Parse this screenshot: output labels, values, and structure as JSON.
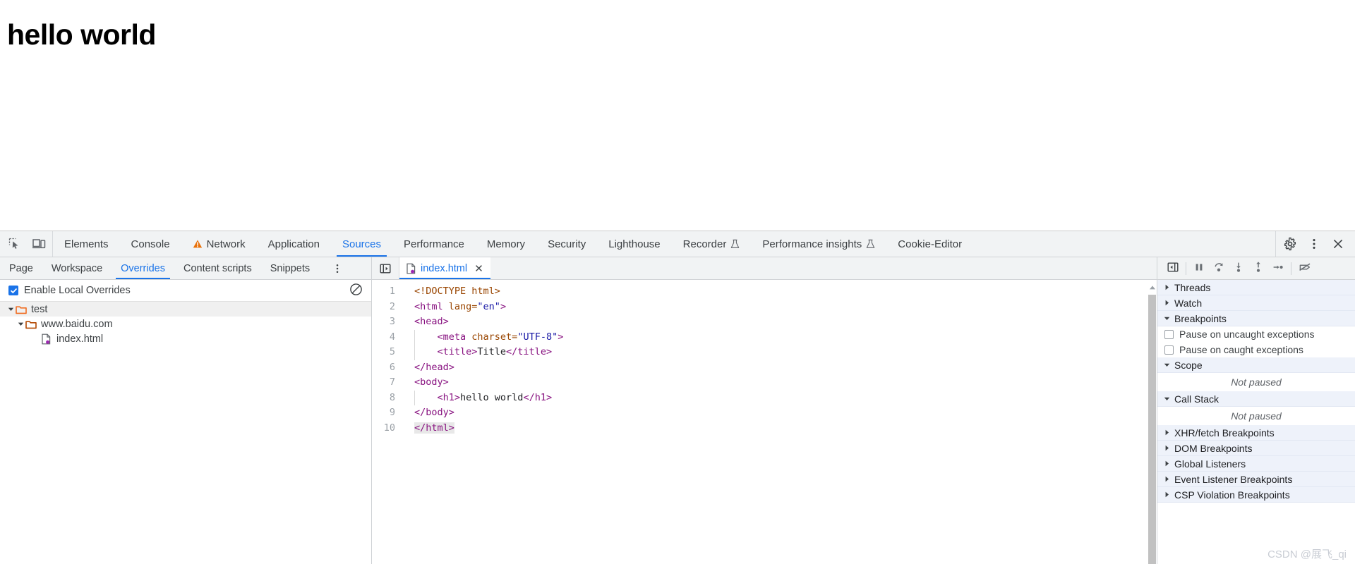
{
  "page": {
    "heading": "hello world"
  },
  "devtools": {
    "left_icons": [
      {
        "name": "inspect-element-icon"
      },
      {
        "name": "device-toolbar-icon"
      }
    ],
    "tabs": [
      {
        "label": "Elements",
        "active": false,
        "icon": null
      },
      {
        "label": "Console",
        "active": false,
        "icon": null
      },
      {
        "label": "Network",
        "active": false,
        "icon": "warning-icon"
      },
      {
        "label": "Application",
        "active": false,
        "icon": null
      },
      {
        "label": "Sources",
        "active": true,
        "icon": null
      },
      {
        "label": "Performance",
        "active": false,
        "icon": null
      },
      {
        "label": "Memory",
        "active": false,
        "icon": null
      },
      {
        "label": "Security",
        "active": false,
        "icon": null
      },
      {
        "label": "Lighthouse",
        "active": false,
        "icon": null
      },
      {
        "label": "Recorder",
        "active": false,
        "icon": "flask-icon"
      },
      {
        "label": "Performance insights",
        "active": false,
        "icon": "flask-icon"
      },
      {
        "label": "Cookie-Editor",
        "active": false,
        "icon": null
      }
    ],
    "right_icons": [
      {
        "name": "settings-gear-icon"
      },
      {
        "name": "more-options-icon"
      },
      {
        "name": "close-icon"
      }
    ],
    "accent_color": "#1a73e8",
    "warning_color": "#e8710a"
  },
  "navigator": {
    "tabs": [
      {
        "label": "Page",
        "active": false
      },
      {
        "label": "Workspace",
        "active": false
      },
      {
        "label": "Overrides",
        "active": true
      },
      {
        "label": "Content scripts",
        "active": false
      },
      {
        "label": "Snippets",
        "active": false
      }
    ],
    "more_label": "More tabs",
    "overrides": {
      "checkbox_label": "Enable Local Overrides",
      "checked": true,
      "clear_button_label": "Clear all overrides"
    },
    "tree": [
      {
        "label": "test",
        "type": "folder",
        "depth": 0,
        "expanded": true,
        "selected": true,
        "folder_color": "#f06c21"
      },
      {
        "label": "www.baidu.com",
        "type": "folder",
        "depth": 1,
        "expanded": true,
        "selected": false,
        "folder_color": "#b34700"
      },
      {
        "label": "index.html",
        "type": "file",
        "depth": 2,
        "expanded": false,
        "selected": false,
        "badge_color": "#9c27b0"
      }
    ]
  },
  "editor": {
    "panel_toggle_label": "Hide navigator",
    "open_file": {
      "name": "index.html",
      "close_label": "Close",
      "has_override_badge": true
    },
    "line_numbers": [
      "1",
      "2",
      "3",
      "4",
      "5",
      "6",
      "7",
      "8",
      "9",
      "10"
    ],
    "code_lines": [
      {
        "n": 1,
        "segments": [
          {
            "t": "<!DOCTYPE html>",
            "c": "tk-doc"
          }
        ]
      },
      {
        "n": 2,
        "segments": [
          {
            "t": "<html ",
            "c": "tk-tag"
          },
          {
            "t": "lang=",
            "c": "tk-attr"
          },
          {
            "t": "\"en\"",
            "c": "tk-val"
          },
          {
            "t": ">",
            "c": "tk-tag"
          }
        ]
      },
      {
        "n": 3,
        "segments": [
          {
            "t": "<head>",
            "c": "tk-tag"
          }
        ]
      },
      {
        "n": 4,
        "segments": [
          {
            "t": "    <meta ",
            "c": "tk-tag"
          },
          {
            "t": "charset=",
            "c": "tk-attr"
          },
          {
            "t": "\"UTF-8\"",
            "c": "tk-val"
          },
          {
            "t": ">",
            "c": "tk-tag"
          }
        ]
      },
      {
        "n": 5,
        "segments": [
          {
            "t": "    <title>",
            "c": "tk-tag"
          },
          {
            "t": "Title",
            "c": "tk-text"
          },
          {
            "t": "</title>",
            "c": "tk-tag"
          }
        ]
      },
      {
        "n": 6,
        "segments": [
          {
            "t": "</head>",
            "c": "tk-tag"
          }
        ]
      },
      {
        "n": 7,
        "segments": [
          {
            "t": "<body>",
            "c": "tk-tag"
          }
        ]
      },
      {
        "n": 8,
        "segments": [
          {
            "t": "    <h1>",
            "c": "tk-tag"
          },
          {
            "t": "hello world",
            "c": "tk-text"
          },
          {
            "t": "</h1>",
            "c": "tk-tag"
          }
        ]
      },
      {
        "n": 9,
        "segments": [
          {
            "t": "</body>",
            "c": "tk-tag"
          }
        ]
      },
      {
        "n": 10,
        "segments": [
          {
            "t": "</html>",
            "c": "tk-tag",
            "selected": true
          }
        ]
      }
    ]
  },
  "debugger": {
    "toolbar_icons": [
      {
        "name": "show-debugger-sidebar-icon"
      },
      {
        "name": "pause-script-icon"
      },
      {
        "name": "step-over-icon"
      },
      {
        "name": "step-into-icon"
      },
      {
        "name": "step-out-icon"
      },
      {
        "name": "step-icon"
      },
      {
        "name": "deactivate-breakpoints-icon"
      }
    ],
    "sections": [
      {
        "kind": "section",
        "label": "Threads",
        "expanded": false
      },
      {
        "kind": "section",
        "label": "Watch",
        "expanded": false
      },
      {
        "kind": "section",
        "label": "Breakpoints",
        "expanded": true
      },
      {
        "kind": "checkbox",
        "label": "Pause on uncaught exceptions",
        "checked": false
      },
      {
        "kind": "checkbox",
        "label": "Pause on caught exceptions",
        "checked": false
      },
      {
        "kind": "section",
        "label": "Scope",
        "expanded": true
      },
      {
        "kind": "empty",
        "label": "Not paused"
      },
      {
        "kind": "section",
        "label": "Call Stack",
        "expanded": true
      },
      {
        "kind": "empty",
        "label": "Not paused"
      },
      {
        "kind": "section",
        "label": "XHR/fetch Breakpoints",
        "expanded": false
      },
      {
        "kind": "section",
        "label": "DOM Breakpoints",
        "expanded": false
      },
      {
        "kind": "section",
        "label": "Global Listeners",
        "expanded": false
      },
      {
        "kind": "section",
        "label": "Event Listener Breakpoints",
        "expanded": false
      },
      {
        "kind": "section",
        "label": "CSP Violation Breakpoints",
        "expanded": false
      }
    ]
  },
  "watermark": {
    "text": "CSDN @展飞_qi"
  }
}
